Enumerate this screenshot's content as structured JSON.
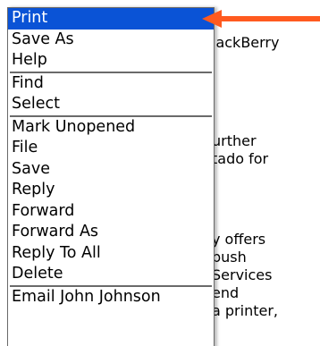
{
  "background_text": [
    "lackBerry",
    "urther",
    "tado for",
    "y offers",
    "push",
    "Services",
    "end",
    "a printer,"
  ],
  "menu": {
    "groups": [
      {
        "items": [
          "Print",
          "Save As",
          "Help"
        ]
      },
      {
        "items": [
          "Find",
          "Select"
        ]
      },
      {
        "items": [
          "Mark Unopened",
          "File",
          "Save",
          "Reply",
          "Forward",
          "Forward As",
          "Reply To All",
          "Delete"
        ]
      },
      {
        "items": [
          "Email John Johnson"
        ]
      }
    ],
    "selected_item": "Print"
  },
  "colors": {
    "highlight": "#0a53d6",
    "arrow": "#ff5a1f",
    "border": "#6a6a6a"
  },
  "icons": {
    "arrow": "arrow-pointer-icon"
  }
}
